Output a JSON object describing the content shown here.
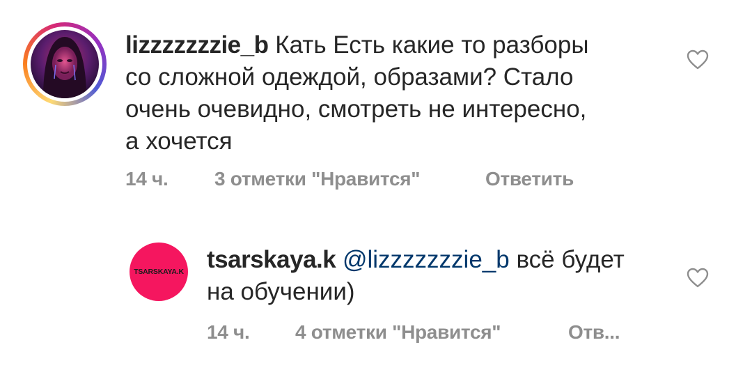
{
  "comments": [
    {
      "username": "lizzzzzzzie_b",
      "text": "Кать Есть какие то разборы со сложной одеждой, образами? Стало очень очевидно, смотреть не интересно, а хочется",
      "lines": [
        "Кать Есть какие то разборы",
        "со сложной одеждой, образами? Стало",
        "очень очевидно, смотреть не интересно,",
        "а хочется"
      ],
      "time": "14 ч.",
      "likes": "3 отметки \"Нравится\"",
      "reply_label": "Ответить",
      "avatar_icon": "profile-photo-with-story-ring"
    },
    {
      "username": "tsarskaya.k",
      "mention": "@lizzzzzzzie_b",
      "text_after_mention": "всё будет",
      "line2": "на обучении)",
      "time": "14 ч.",
      "likes": "4 отметки \"Нравится\"",
      "reply_label": "Отв...",
      "avatar_text": "TSARSKAYA.K",
      "avatar_color": "#f5165f"
    }
  ],
  "icons": {
    "like": "heart-outline-icon"
  },
  "colors": {
    "text": "#262626",
    "meta": "#8e8e8e",
    "mention": "#00376b",
    "heart": "#8e8e8e"
  }
}
